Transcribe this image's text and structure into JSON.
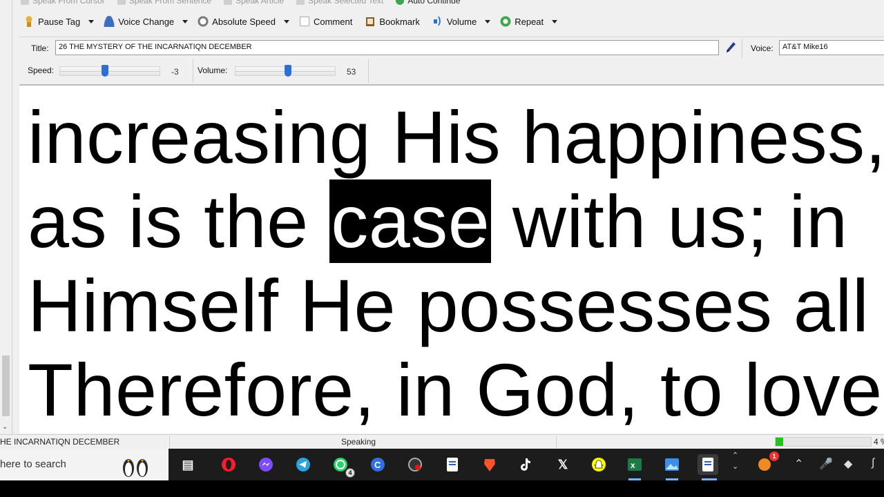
{
  "toolbar_top": {
    "items": [
      {
        "label": "Speak From Cursor",
        "icon": "speak-cursor-icon"
      },
      {
        "label": "Speak From Sentence",
        "icon": "speak-sentence-icon"
      },
      {
        "label": "Speak Article",
        "icon": "speak-article-icon"
      },
      {
        "label": "Speak Selected Text",
        "icon": "speak-selected-icon"
      },
      {
        "label": "Auto Continue",
        "icon": "auto-continue-icon"
      }
    ]
  },
  "toolbar": {
    "pause_tag": "Pause Tag",
    "voice_change": "Voice Change",
    "absolute_speed": "Absolute Speed",
    "comment": "Comment",
    "bookmark": "Bookmark",
    "volume": "Volume",
    "repeat": "Repeat"
  },
  "title_row": {
    "title_label": "Title:",
    "title_value": "26 THE MYSTERY OF THE INCARNATIQN DECEMBER",
    "voice_label": "Voice:",
    "voice_value": "AT&T Mike16"
  },
  "sliders": {
    "speed_label": "Speed:",
    "speed_value": "-3",
    "speed_position": 0.45,
    "volume_label": "Volume:",
    "volume_value": "53",
    "volume_position": 0.53
  },
  "reader": {
    "line1": "increasing His happiness,",
    "line2_before": "as is the ",
    "line2_highlight": "case",
    "line2_after": " with us; in",
    "line3": "Himself He possesses all",
    "line4": "Therefore, in God, to love"
  },
  "status": {
    "document": "HE INCARNATIQN DECEMBER",
    "state": "Speaking",
    "percent": "4 %",
    "progress": 0.04,
    "progress_color": "#1fc41f"
  },
  "taskbar": {
    "search_placeholder": "here to search",
    "whatsapp_badge": "4",
    "notification_badge": "1"
  }
}
